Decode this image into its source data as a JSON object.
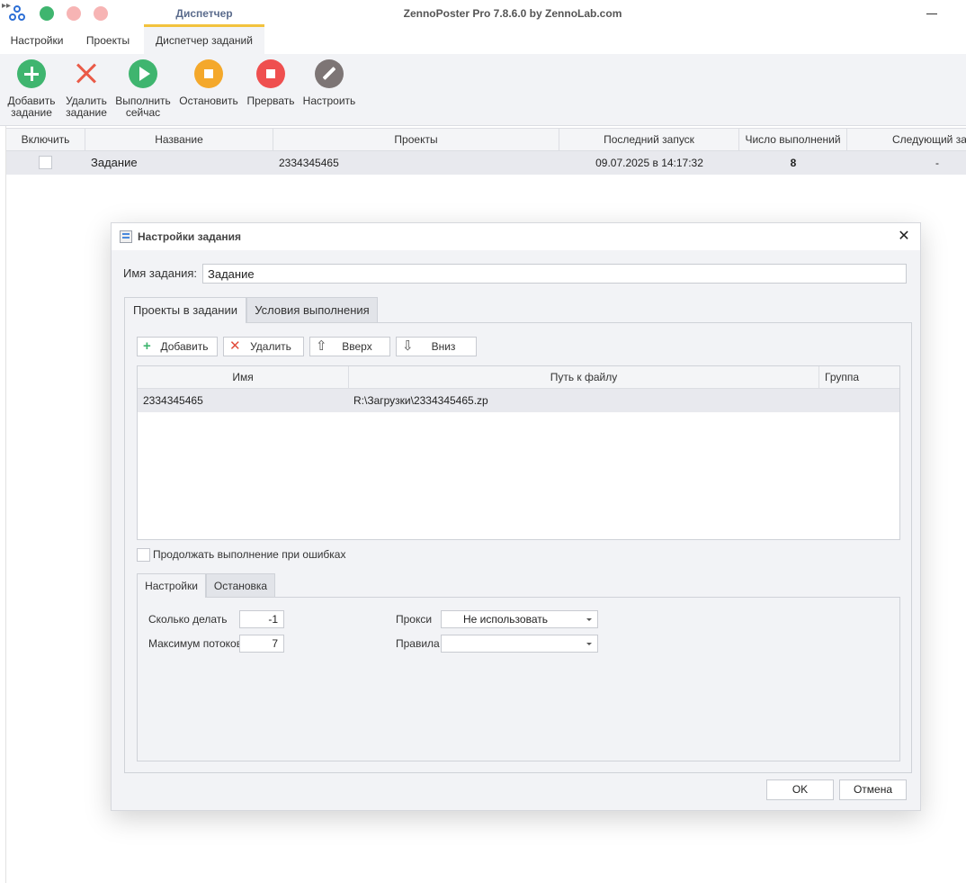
{
  "window": {
    "title": "ZennoPoster Pro 7.8.6.0 by ZennoLab.com",
    "context_tab": "Диспетчер"
  },
  "ribbon_tabs": [
    "Настройки",
    "Проекты",
    "Диспетчер заданий"
  ],
  "ribbon_buttons": {
    "add": "Добавить задание",
    "remove": "Удалить задание",
    "run_now": "Выполнить сейчас",
    "stop": "Остановить",
    "abort": "Прервать",
    "configure": "Настроить"
  },
  "colors": {
    "green": "#3fb56f",
    "orange": "#f4a82b",
    "red": "#ef4f4f",
    "gray": "#7d7575",
    "accent_tab": "#f2c23d"
  },
  "tasks_table": {
    "columns": [
      "Включить",
      "Название",
      "Проекты",
      "Последний запуск",
      "Число выполнений",
      "Следующий запуск"
    ],
    "rows": [
      {
        "enabled": false,
        "name": "Задание",
        "projects": "2334345465",
        "last_run": "09.07.2025 в 14:17:32",
        "run_count": "8",
        "next_run": "-"
      }
    ]
  },
  "dialog": {
    "title": "Настройки задания",
    "close": "✕",
    "name_label": "Имя задания:",
    "name_value": "Задание",
    "tabs": [
      "Проекты в задании",
      "Условия выполнения"
    ],
    "toolbar": {
      "add": "Добавить",
      "remove": "Удалить",
      "up": "Вверх",
      "down": "Вниз"
    },
    "projects_table": {
      "columns": [
        "Имя",
        "Путь к файлу",
        "Группа"
      ],
      "rows": [
        {
          "name": "2334345465",
          "path": "R:\\Загрузки\\2334345465.zp",
          "group": ""
        }
      ]
    },
    "continue_on_errors": "Продолжать выполнение при ошибках",
    "sub_tabs": [
      "Настройки",
      "Остановка"
    ],
    "settings": {
      "how_many_label": "Сколько делать",
      "how_many_value": "-1",
      "max_threads_label": "Максимум потоков",
      "max_threads_value": "7",
      "proxy_label": "Прокси",
      "proxy_value": "Не использовать",
      "rules_label": "Правила",
      "rules_value": ""
    },
    "ok": "OK",
    "cancel": "Отмена"
  }
}
